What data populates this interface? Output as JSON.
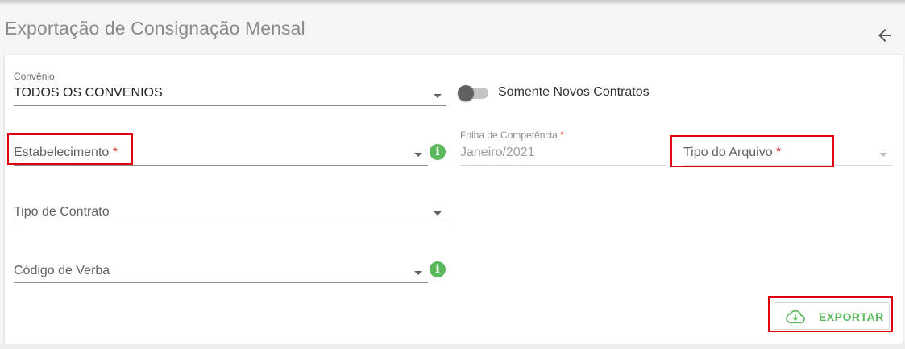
{
  "page": {
    "title": "Exportação de Consignação Mensal"
  },
  "form": {
    "convenio": {
      "label": "Convênio",
      "value": "TODOS OS CONVENIOS"
    },
    "somente_novos": {
      "label": "Somente Novos Contratos",
      "checked": false
    },
    "estabelecimento": {
      "label": "Estabelecimento",
      "required": "*"
    },
    "folha_competencia": {
      "label": "Folha de Competência",
      "required": "*",
      "value": "Janeiro/2021"
    },
    "tipo_arquivo": {
      "label": "Tipo do Arquivo",
      "required": "*"
    },
    "tipo_contrato": {
      "label": "Tipo de Contrato"
    },
    "codigo_verba": {
      "label": "Código de Verba"
    }
  },
  "actions": {
    "export_label": "EXPORTAR"
  },
  "colors": {
    "accent_green": "#5cb85c",
    "required_red": "#e53935",
    "annotation_red": "#e0000f"
  },
  "icons": {
    "back": "arrow-left-icon",
    "info": "info-icon",
    "export": "cloud-download-icon",
    "dropdown": "caret-down-icon"
  }
}
